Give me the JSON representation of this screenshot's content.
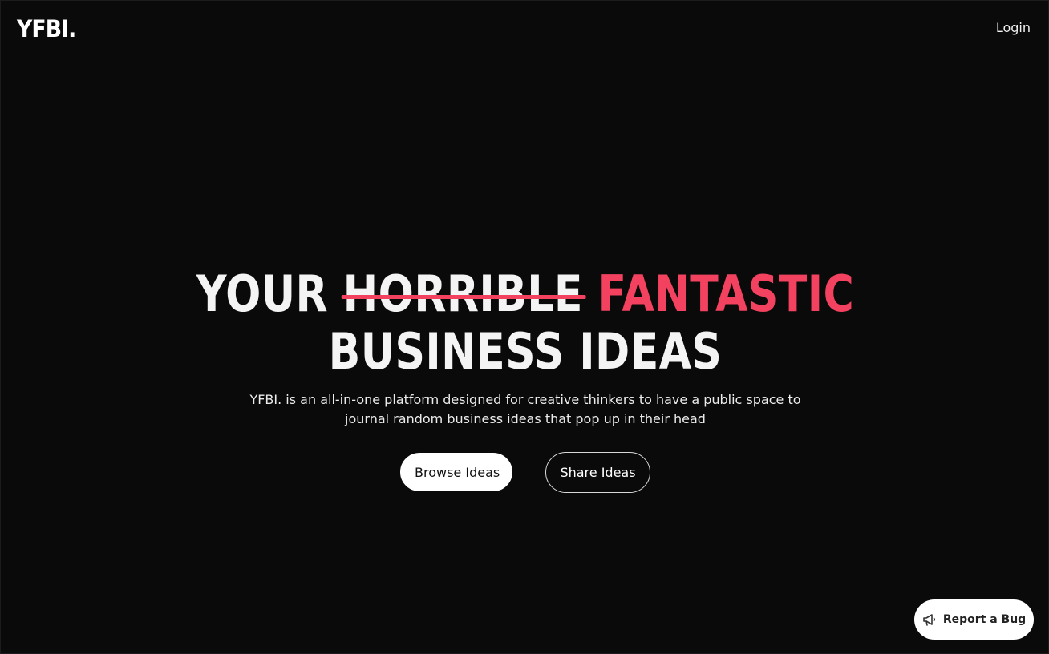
{
  "header": {
    "logo_text": "YFBI.",
    "login_label": "Login"
  },
  "hero": {
    "headline": {
      "word_your": "YOUR",
      "word_struck": "HORRIBLE",
      "word_accent": "FANTASTIC",
      "line2": "BUSINESS IDEAS"
    },
    "description_line1": "YFBI. is an all-in-one platform designed for creative thinkers to have a public space to",
    "description_line2": "journal random business ideas that pop up in their head",
    "browse_label": "Browse Ideas",
    "share_label": "Share Ideas"
  },
  "report_bug": {
    "label": "Report a Bug",
    "icon": "megaphone-icon"
  },
  "colors": {
    "background": "#0a0a0a",
    "accent": "#f2425f",
    "text": "#ffffff"
  }
}
